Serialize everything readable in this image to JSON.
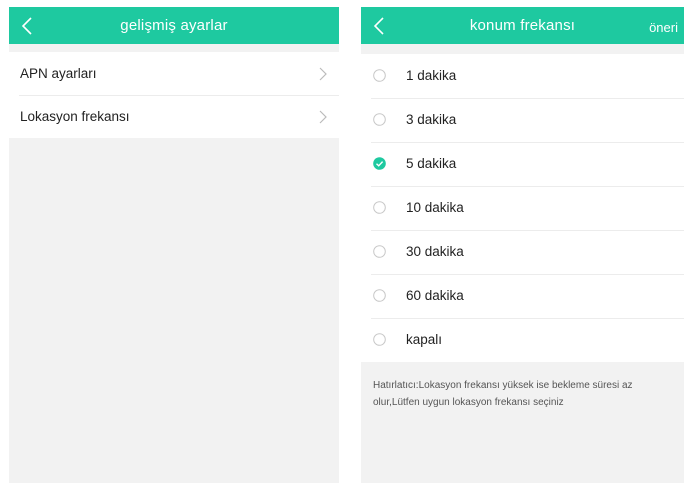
{
  "left_screen": {
    "header": {
      "title": "gelişmiş ayarlar"
    },
    "items": [
      {
        "label": "APN ayarları"
      },
      {
        "label": "Lokasyon frekansı"
      }
    ]
  },
  "right_screen": {
    "header": {
      "title": "konum frekansı",
      "action": "öneri"
    },
    "options": [
      {
        "label": "1 dakika",
        "selected": false
      },
      {
        "label": "3 dakika",
        "selected": false
      },
      {
        "label": "5 dakika",
        "selected": true
      },
      {
        "label": "10 dakika",
        "selected": false
      },
      {
        "label": "30 dakika",
        "selected": false
      },
      {
        "label": "60 dakika",
        "selected": false
      },
      {
        "label": "kapalı",
        "selected": false
      }
    ],
    "hint": "Hatırlatıcı:Lokasyon frekansı yüksek ise bekleme süresi az olur,Lütfen uygun lokasyon frekansı seçiniz"
  },
  "colors": {
    "accent": "#1ec9a0",
    "background": "#f2f2f2",
    "radio_off": "#c8c8c8"
  },
  "icons": {
    "back": "chevron-left-icon",
    "disclosure": "chevron-right-icon",
    "radio_on": "check-circle-icon",
    "radio_off": "radio-empty-icon"
  }
}
